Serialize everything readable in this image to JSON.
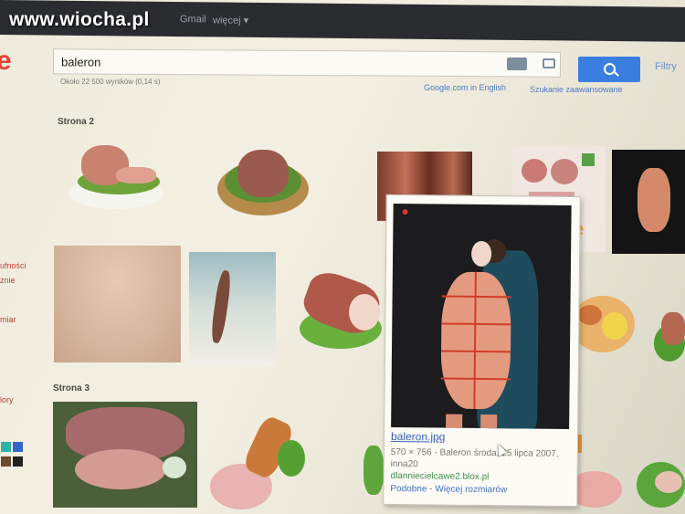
{
  "watermark": "www.wiocha.pl",
  "topbar": {
    "gmail": "Gmail",
    "more": "więcej ▾"
  },
  "logo_fragment": "e",
  "search": {
    "query": "baleron",
    "button_icon": "search-icon"
  },
  "filters_label": "Filtry",
  "result_stats": "Około 22 500 wyników (0,14 s)",
  "links": {
    "lang": "Google.com in English",
    "advanced": "Szukanie zaawansowane"
  },
  "sections": {
    "page2": "Strona 2",
    "page3": "Strona 3"
  },
  "sidebar": {
    "item1": "ufności",
    "item2": "znie",
    "item3": "miar",
    "item4": "lory"
  },
  "popup": {
    "file": "baleron.jpg",
    "meta": "570 × 756 - Baleron  środa, 25 lipca 2007, inna20",
    "site": "dlanniecielcawe2.blox.pl",
    "similar": "Podobne",
    "sep": " - ",
    "sizes": "Więcej rozmiarów"
  },
  "colors": {
    "topbar": "#2b2c30",
    "search_button": "#3a7fe0",
    "link": "#4470c6"
  }
}
